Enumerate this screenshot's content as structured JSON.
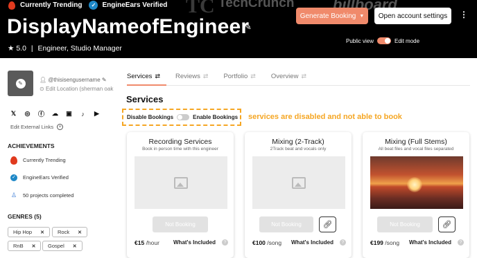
{
  "header": {
    "trending_label": "Currently Trending",
    "verified_label": "EngineEars Verified",
    "press_logos": [
      "TC",
      "TechCrunch",
      "billboard"
    ],
    "display_name": "DisplayNameofEngineer",
    "rating": "★ 5.0",
    "separator": "|",
    "roles": "Engineer, Studio Manager",
    "generate_booking_label": "Generate Booking",
    "open_settings_label": "Open account settings",
    "public_view_label": "Public view",
    "edit_mode_label": "Edit mode",
    "accent_color": "#f08a6b"
  },
  "profile": {
    "username": "@thisisengusername",
    "location": "Edit Location (sherman oak",
    "socials": [
      "x-icon",
      "instagram-icon",
      "facebook-icon",
      "soundcloud-icon",
      "twitch-icon",
      "tiktok-icon",
      "youtube-icon"
    ],
    "edit_links_label": "Edit External Links",
    "achievements_title": "ACHIEVEMENTS",
    "achievements": [
      "Currently Trending",
      "EngineEars Verified",
      "50 projects completed"
    ],
    "genres_title": "GENRES (5)",
    "genres": [
      "Hip Hop",
      "Rock",
      "RnB",
      "Gospel"
    ]
  },
  "tabs": [
    "Services",
    "Reviews",
    "Portfolio",
    "Overview"
  ],
  "services": {
    "title": "Services",
    "disable_label": "Disable Bookings",
    "enable_label": "Enable Bookings",
    "note": "services are disabled and not able to book",
    "not_booking_label": "Not Booking",
    "included_label": "What's Included",
    "cards": [
      {
        "title": "Recording Services",
        "subtitle": "Book in person time with this engineer",
        "price": "€15",
        "unit": "/hour"
      },
      {
        "title": "Mixing (2-Track)",
        "subtitle": "2Track beat and vocals only",
        "price": "€100",
        "unit": "/song"
      },
      {
        "title": "Mixing (Full Stems)",
        "subtitle": "All beat files and vocal files separated",
        "price": "€199",
        "unit": "/song"
      }
    ]
  }
}
